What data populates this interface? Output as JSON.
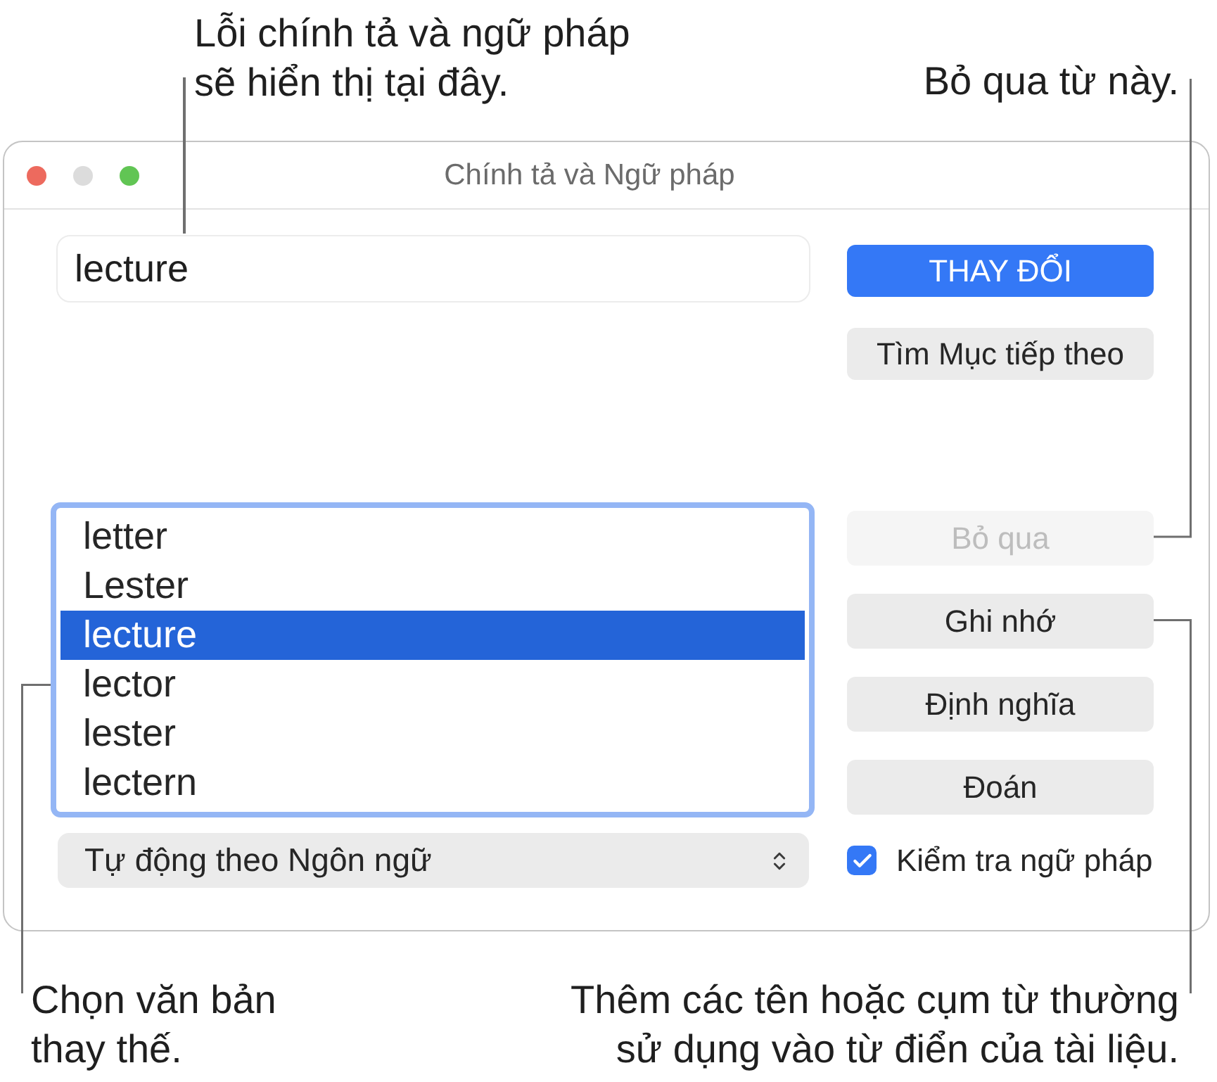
{
  "callouts": [
    {
      "text": "Lỗi chính tả và ngữ pháp\nsẽ hiển thị tại đây."
    },
    {
      "text": "Bỏ qua từ này."
    },
    {
      "text": "Chọn văn bản\nthay thế."
    },
    {
      "text": "Thêm các tên hoặc cụm từ thường\nsử dụng vào từ điển của tài liệu."
    }
  ],
  "window": {
    "title": "Chính tả và Ngữ pháp",
    "controls": [
      {
        "kind": "close",
        "disabled": false
      },
      {
        "kind": "minimize",
        "disabled": true
      },
      {
        "kind": "zoom",
        "disabled": false
      }
    ]
  },
  "word_field": {
    "value": "lecture"
  },
  "top_buttons": [
    {
      "kind": "primary",
      "label": "THAY ĐỔI",
      "disabled": false
    },
    {
      "kind": "normal",
      "label": "Tìm Mục tiếp theo",
      "disabled": false
    }
  ],
  "guesses": [
    {
      "label": "letter",
      "selected": false
    },
    {
      "label": "Lester",
      "selected": false
    },
    {
      "label": "lecture",
      "selected": true
    },
    {
      "label": "lector",
      "selected": false
    },
    {
      "label": "lester",
      "selected": false
    },
    {
      "label": "lectern",
      "selected": false
    }
  ],
  "side_buttons": [
    {
      "kind": "normal",
      "label": "Bỏ qua",
      "disabled": true
    },
    {
      "kind": "normal",
      "label": "Ghi nhớ",
      "disabled": false
    },
    {
      "kind": "normal",
      "label": "Định nghĩa",
      "disabled": false
    },
    {
      "kind": "normal",
      "label": "Đoán",
      "disabled": false
    }
  ],
  "language_popup": {
    "value": "Tự động theo Ngôn ngữ"
  },
  "grammar_check": {
    "label": "Kiểm tra ngữ pháp",
    "checked": true
  }
}
